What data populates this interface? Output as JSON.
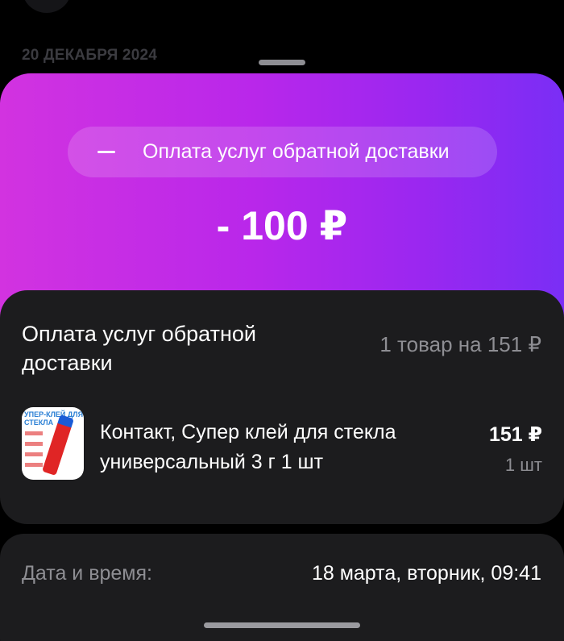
{
  "background": {
    "date_header": "20 ДЕКАБРЯ 2024"
  },
  "hero": {
    "pill_text": "Оплата услуг обратной доставки",
    "pill_icon": "minus-icon",
    "amount": "- 100 ₽",
    "gradient_colors": [
      "#d233e0",
      "#7a2ef5"
    ]
  },
  "order": {
    "title": "Оплата услуг обратной доставки",
    "summary": "1 товар на 151 ₽",
    "items": [
      {
        "name": "Контакт, Супер клей для стекла универсальный 3 г 1 шт",
        "price": "151 ₽",
        "quantity": "1 шт",
        "thumb_text": "УПЕР-КЛЕЙ ДЛЯ СТЕКЛА"
      }
    ]
  },
  "details": {
    "date_label": "Дата и время:",
    "date_value": "18 марта, вторник, 09:41"
  }
}
